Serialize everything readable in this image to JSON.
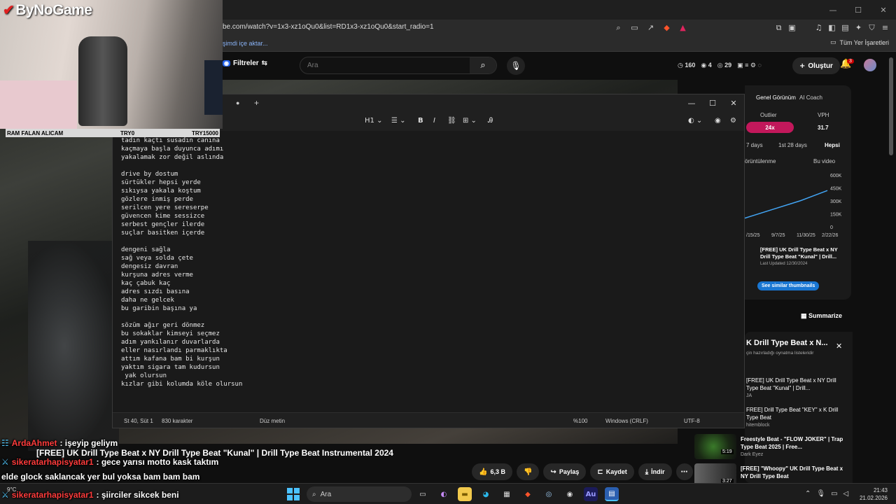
{
  "browser": {
    "url": "be.com/watch?v=1x3-xz1oQu0&list=RD1x3-xz1oQu0&start_radio=1",
    "import_link": "şimdi içe aktar...",
    "all_bookmarks": "Tüm Yer İşaretleri",
    "window_controls": [
      "—",
      "☐",
      "✕"
    ]
  },
  "youtube": {
    "filters_label": "Filtreler",
    "search_placeholder": "Ara",
    "stats": {
      "a": "160",
      "b": "4",
      "c": "29"
    },
    "login_label": "Oluştur",
    "notif_count": "3"
  },
  "stream": {
    "brand": "ByNoGame",
    "banner_left": "RAM FALAN ALICAM",
    "banner_mid": "TRY0",
    "banner_right": "TRY15000"
  },
  "notepad": {
    "toolbar": {
      "heading": "H1"
    },
    "lines": [
      "tadın kaçtı susadın canına",
      "kaçmaya başla duyunca adımı",
      "yakalamak zor değil aslında",
      "",
      "drive by dostum",
      "sürtükler hepsi yerde",
      "sıkıysa yakala koştum",
      "gözlere inmiş perde",
      "serilcen yere sereserpe",
      "güvencen kime sessizce",
      "serbest gençler ilerde",
      "suçlar basitken içerde",
      "",
      "dengeni sağla",
      "sağ veya solda çete",
      "dengesiz davran",
      "kurşuna adres verme",
      "kaç çabuk kaç",
      "adres sızdı basına",
      "daha ne gelcek",
      "bu garibin başına ya",
      "",
      "sözüm ağır geri dönmez",
      "bu sokaklar kimseyi seçmez",
      "adım yankılanır duvarlarda",
      "eller nasırlandı parmaklıkta",
      "attım kafana bam bi kurşun",
      "yaktım sigara tam kudursun",
      " yak olursun",
      "kızlar gibi kolumda köle olursun"
    ],
    "status": {
      "position": "St 40, Süt 1",
      "chars": "830 karakter",
      "format": "Düz metin",
      "zoom": "%100",
      "eol": "Windows (CRLF)",
      "encoding": "UTF-8"
    }
  },
  "panel": {
    "tabs": [
      "Genel Görünüm",
      "AI Coach"
    ],
    "outlier_label": "Outlier",
    "outlier_value": "24x",
    "vph_label": "VPH",
    "vph_value": "31.7",
    "periods": [
      "7 days",
      "1st 28 days",
      "Hepsi"
    ],
    "view_label": "örüntülenme",
    "this_video": "Bu video",
    "y_ticks": [
      "600K",
      "450K",
      "300K",
      "150K",
      "0"
    ],
    "x_ticks": [
      "/15/25",
      "9/7/25",
      "11/30/25",
      "2/22/26"
    ],
    "suggest_title": "[FREE] UK Drill Type Beat x NY Drill Type Beat \"Kunal\" | Drill...",
    "suggest_updated": "Last Updated 12/30/2024",
    "similar_btn": "See similar thumbnails",
    "summarize": "Summarize"
  },
  "chart_data": {
    "type": "line",
    "series": [
      {
        "name": "Bu video",
        "x": [
          "6/15/25",
          "9/7/25",
          "11/30/25",
          "2/22/26"
        ],
        "values": [
          100000,
          200000,
          300000,
          420000
        ]
      }
    ],
    "ylim": [
      0,
      600000
    ]
  },
  "playlist": {
    "title": "K Drill Type Beat x N...",
    "sub": "çin hazırladığı oynatma listeleridir",
    "items": [
      {
        "title": "[FREE] UK Drill Type Beat x NY Drill Type Beat \"Kunal\" | Drill...",
        "sub": "JA"
      },
      {
        "title": "FREE] Drill Type Beat \"KEY\" x K Drill Type Beat",
        "sub": "hitemblock"
      }
    ]
  },
  "recommendations": [
    {
      "title": "Freestyle Beat - \"FLOW JOKER\" | Trap Type Beat 2025 | Free...",
      "sub": "Dark Eyez",
      "dur": "5:19"
    },
    {
      "title": "[FREE] \"Whoopy\" UK Drill Type Beat x NY Drill Type Beat",
      "sub": "",
      "dur": "3:27"
    }
  ],
  "video": {
    "title": "[FREE] UK Drill Type Beat x NY Drill Type Beat \"Kunal\" | Drill Type Beat Instrumental 2024",
    "likes": "6,3 B",
    "share": "Paylaş",
    "save": "Kaydet",
    "download": "İndir"
  },
  "chat": [
    {
      "user": "ArdaAhmet",
      "msg": ": işeyip geliym"
    },
    {
      "user": "sikeratarhapisyatar1",
      "msg": ": gece yarısı motto kask taktım"
    },
    {
      "user": "",
      "msg": "elde glock saklancak yer bul yoksa bam bam bam"
    },
    {
      "user": "sikeratarhapisyatar1",
      "msg": ": şiirciler sikcek beni"
    }
  ],
  "taskbar": {
    "search": "Ara",
    "weather": "9°C",
    "time": "21:43",
    "date": "21.02.2026"
  }
}
